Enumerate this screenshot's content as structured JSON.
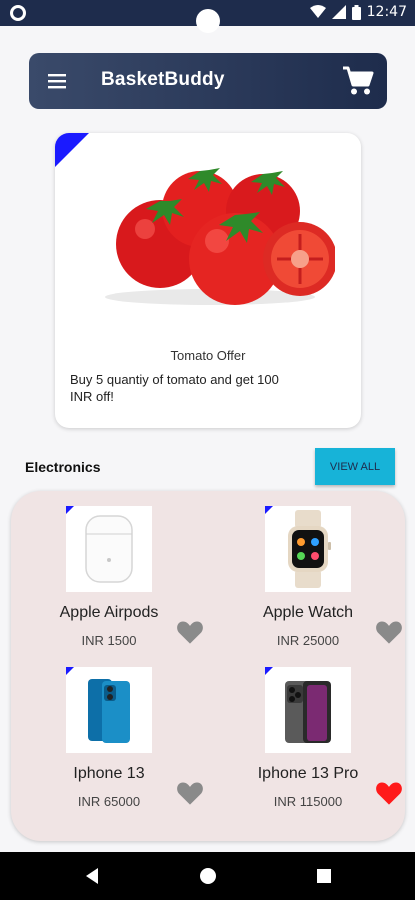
{
  "status_bar": {
    "time": "12:47"
  },
  "app_bar": {
    "title": "BasketBuddy",
    "menu_icon": "menu-icon",
    "cart_icon": "shopping-cart-icon"
  },
  "offer": {
    "title": "Tomato Offer",
    "description": "Buy 5 quantiy of tomato and get 100 INR off!",
    "image": "tomato-image"
  },
  "section": {
    "title": "Electronics",
    "view_all_label": "VIEW ALL"
  },
  "products": [
    {
      "name": "Apple Airpods",
      "price": "INR 1500",
      "favorite": false
    },
    {
      "name": "Apple Watch",
      "price": "INR 25000",
      "favorite": false
    },
    {
      "name": "Iphone 13",
      "price": "INR 65000",
      "favorite": false
    },
    {
      "name": "Iphone 13 Pro",
      "price": "INR 115000",
      "favorite": true
    }
  ],
  "colors": {
    "app_bar": "#1e2c4c",
    "accent": "#17b3d8",
    "corner_tag": "#1a1aff",
    "favorite_active": "#ff1a1a",
    "favorite_inactive": "#8a8a8a"
  }
}
